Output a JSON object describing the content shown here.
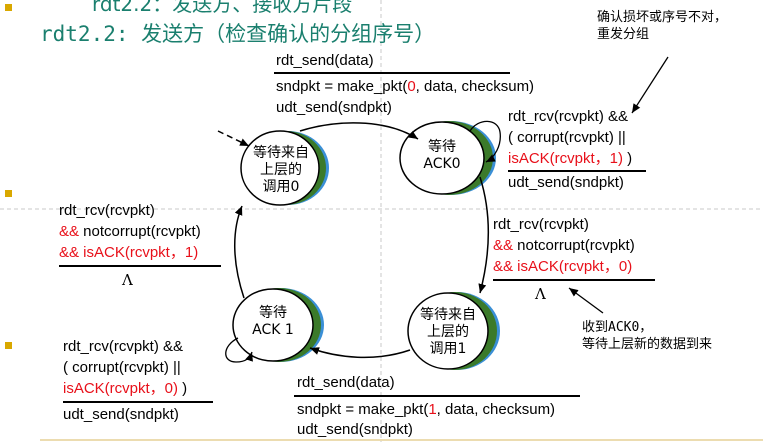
{
  "header": {
    "top_cut_text": "rdt2.2：发送方、接收方片段",
    "title": "rdt2.2: 发送方（检查确认的分组序号）"
  },
  "notes": {
    "resend_line1": "确认损坏或序号不对，",
    "resend_line2": "重发分组",
    "ack0_line1": "收到ACK0，",
    "ack0_line2": "等待上层新的数据到来"
  },
  "states": {
    "wait_call0": [
      "等待来自",
      "上层的",
      "调用0"
    ],
    "wait_ack0": [
      "等待",
      "ACK0"
    ],
    "wait_call1": [
      "等待来自",
      "上层的",
      "调用1"
    ],
    "wait_ack1": [
      "等待",
      "ACK 1"
    ]
  },
  "transitions": {
    "top": {
      "event": "rdt_send(data)",
      "action1_pre": "sndpkt = make_pkt(",
      "action1_seq": "0",
      "action1_post": ", data, checksum)",
      "action2": "udt_send(sndpkt)"
    },
    "ack0_self": {
      "line1": "rdt_rcv(rcvpkt) &&",
      "line2": "( corrupt(rcvpkt) ||",
      "line3_red": "isACK(rcvpkt，1)",
      "line3_close": " )",
      "action": "udt_send(sndpkt)"
    },
    "right": {
      "line1": "rdt_rcv(rcvpkt)",
      "line2_and": "&&",
      "line2_rest": " notcorrupt(rcvpkt)",
      "line3_red": "&& isACK(rcvpkt，0)",
      "action": "Λ"
    },
    "left": {
      "line1": "rdt_rcv(rcvpkt)",
      "line2_and": "&&",
      "line2_rest": " notcorrupt(rcvpkt)",
      "line3_red": "&& isACK(rcvpkt，1)",
      "action": "Λ"
    },
    "ack1_self": {
      "line1": "rdt_rcv(rcvpkt) &&",
      "line2": "( corrupt(rcvpkt) ||",
      "line3_red": "isACK(rcvpkt，0)",
      "line3_close": " )",
      "action": "udt_send(sndpkt)"
    },
    "bottom": {
      "event": "rdt_send(data)",
      "action1_pre": "sndpkt = make_pkt(",
      "action1_seq": "1",
      "action1_post": ", data, checksum)",
      "action2": "udt_send(sndpkt)"
    }
  },
  "colors": {
    "title": "#1a7f6e",
    "red": "#e8101a",
    "state_shadow_green": "#3b7a2a",
    "state_shadow_blue": "#3a8fd6",
    "bullet": "#d9a800"
  }
}
